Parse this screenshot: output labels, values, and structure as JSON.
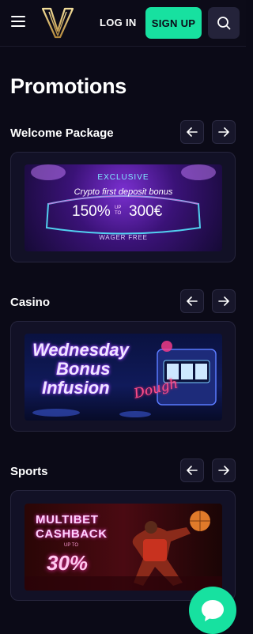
{
  "header": {
    "login_label": "LOG IN",
    "signup_label": "SIGN UP",
    "accent_color": "#17e1a0",
    "logo_icon": "v-logo-icon"
  },
  "page": {
    "title": "Promotions"
  },
  "sections": [
    {
      "title": "Welcome Package",
      "banner": {
        "badge": "EXCLUSIVE",
        "headline": "Crypto first deposit bonus",
        "percent": "150%",
        "up_to": "UP TO",
        "amount": "300€",
        "footer": "WAGER FREE"
      }
    },
    {
      "title": "Casino",
      "banner": {
        "line1": "Wednesday",
        "line2": "Bonus",
        "line3": "Infusion",
        "script": "Dough"
      }
    },
    {
      "title": "Sports",
      "banner": {
        "line1": "MULTIBET",
        "line2": "CASHBACK",
        "up_to": "UP TO",
        "percent": "30%"
      }
    }
  ],
  "icons": {
    "prev": "arrow-left-icon",
    "next": "arrow-right-icon",
    "menu": "hamburger-icon",
    "search": "search-icon",
    "chat": "chat-bubble-icon"
  }
}
